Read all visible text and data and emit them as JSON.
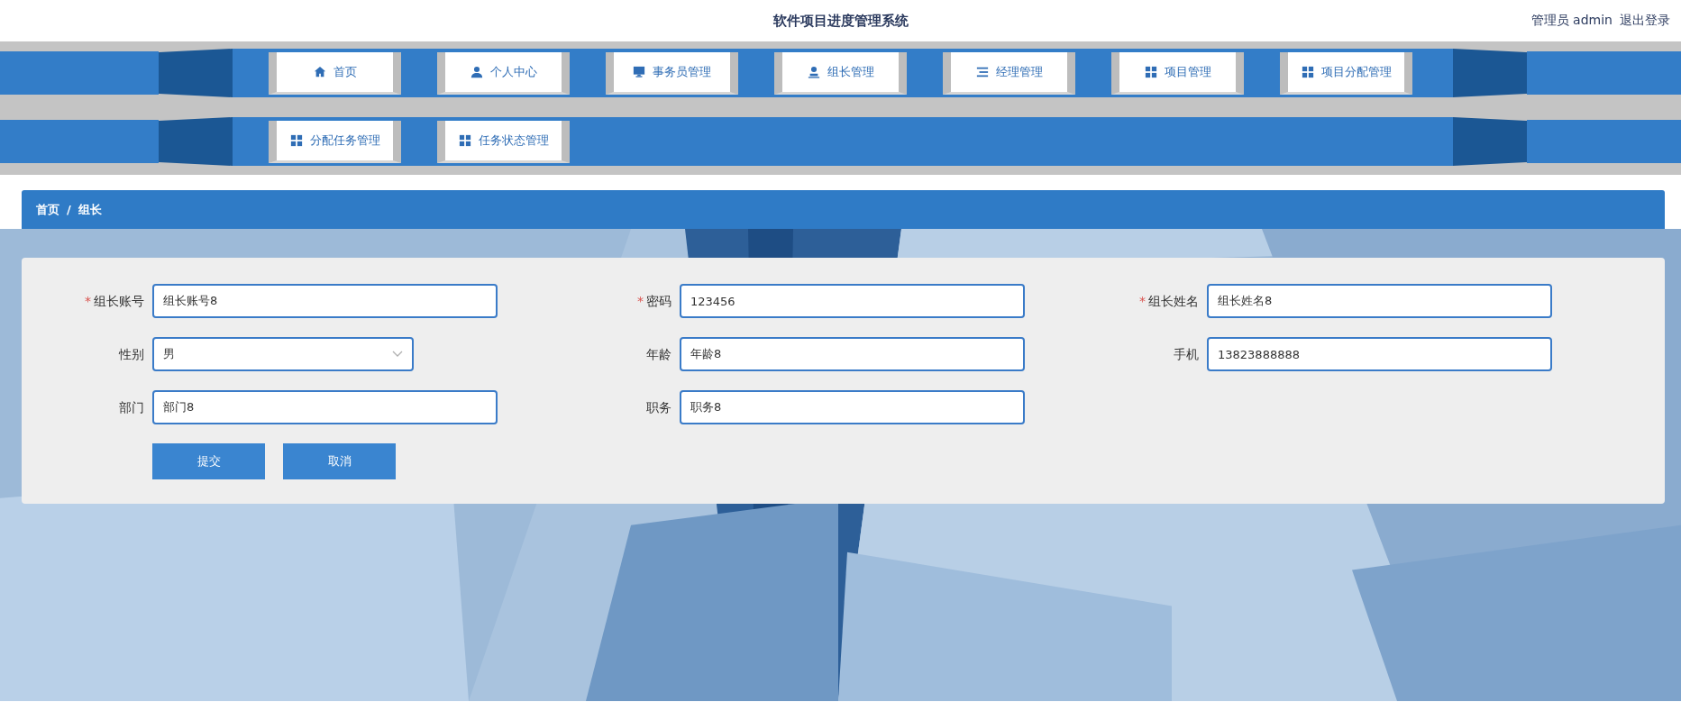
{
  "header": {
    "title": "软件项目进度管理系统",
    "user": "管理员 admin",
    "logout": "退出登录"
  },
  "nav_rows": [
    [
      {
        "label": "首页",
        "kind": "home"
      },
      {
        "label": "个人中心",
        "kind": "person"
      },
      {
        "label": "事务员管理",
        "kind": "monitor"
      },
      {
        "label": "组长管理",
        "kind": "stamp"
      },
      {
        "label": "经理管理",
        "kind": "list"
      },
      {
        "label": "项目管理",
        "kind": "grid"
      },
      {
        "label": "项目分配管理",
        "kind": "grid"
      }
    ],
    [
      {
        "label": "分配任务管理",
        "kind": "grid"
      },
      {
        "label": "任务状态管理",
        "kind": "grid"
      }
    ]
  ],
  "breadcrumb": {
    "items": [
      "首页",
      "组长"
    ],
    "separator": "/"
  },
  "form": {
    "rows": [
      [
        {
          "label": "组长账号",
          "marker": "*",
          "kind": "input",
          "value": "组长账号8"
        },
        {
          "label": "密码",
          "marker": "*",
          "kind": "input",
          "value": "123456"
        },
        {
          "label": "组长姓名",
          "marker": "*",
          "kind": "input",
          "value": "组长姓名8"
        }
      ],
      [
        {
          "label": "性别",
          "kind": "select",
          "value": "男"
        },
        {
          "label": "年龄",
          "kind": "input",
          "value": "年龄8"
        },
        {
          "label": "手机",
          "kind": "input",
          "value": "13823888888"
        }
      ],
      [
        {
          "label": "部门",
          "kind": "input",
          "value": "部门8"
        },
        {
          "label": "职务",
          "kind": "input",
          "value": "职务8"
        }
      ]
    ],
    "buttons": [
      "提交",
      "取消"
    ]
  }
}
